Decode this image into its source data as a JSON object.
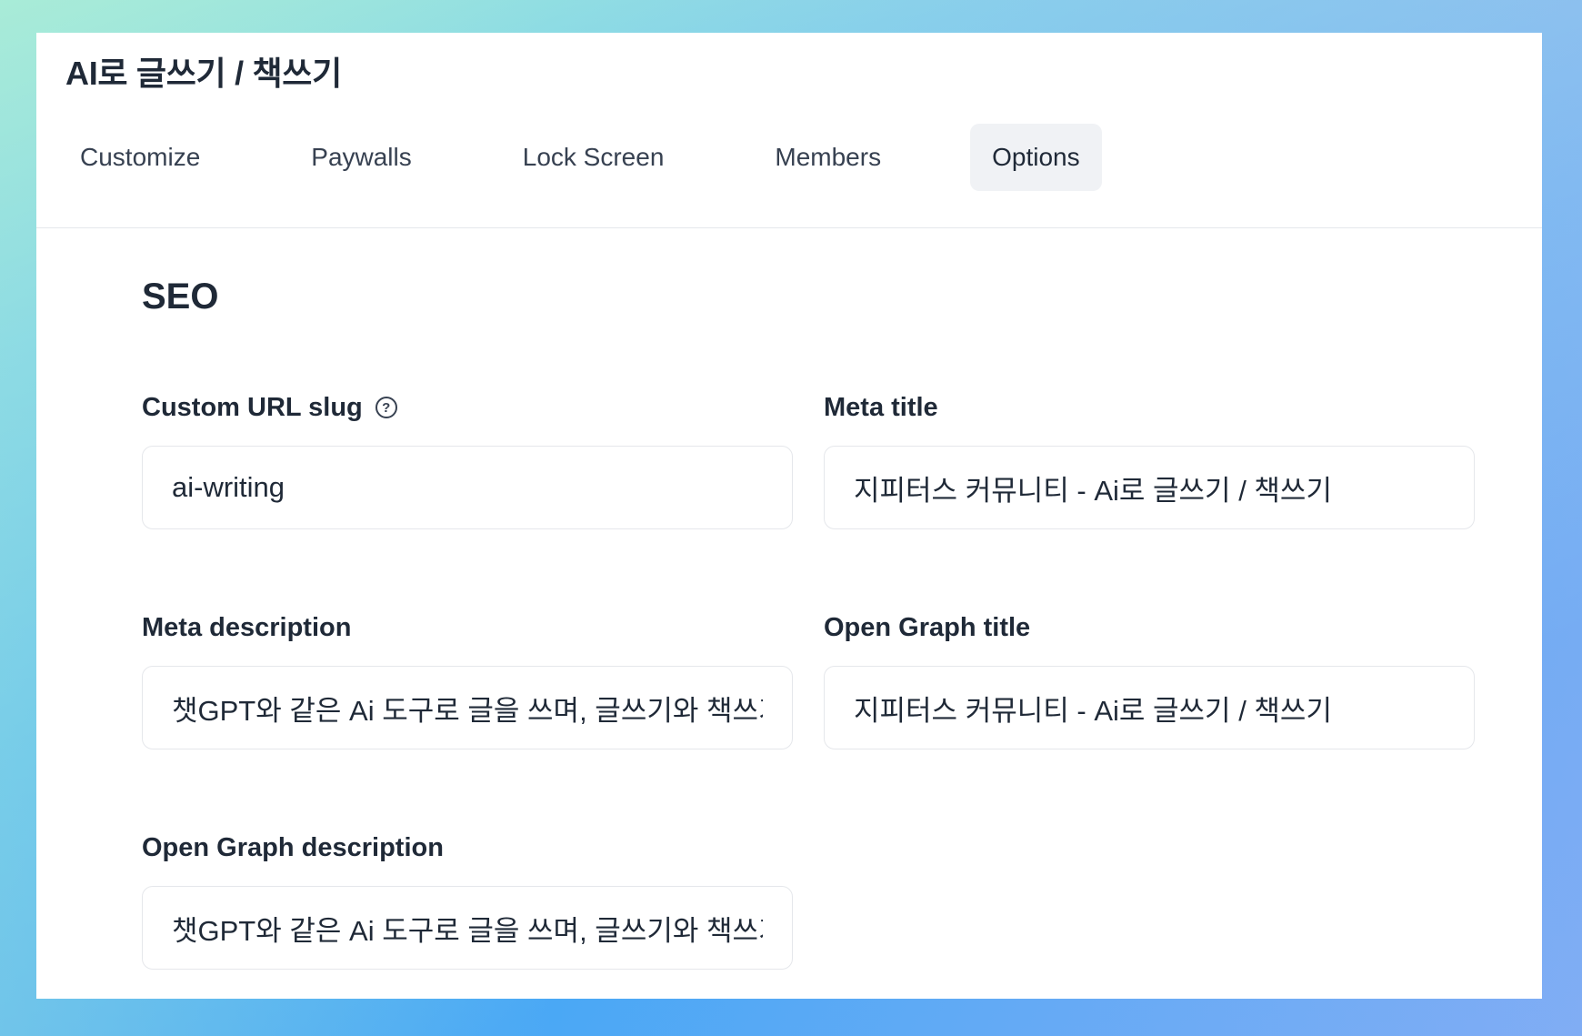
{
  "header": {
    "title": "AI로 글쓰기 / 책쓰기"
  },
  "tabs": [
    {
      "label": "Customize",
      "active": false
    },
    {
      "label": "Paywalls",
      "active": false
    },
    {
      "label": "Lock Screen",
      "active": false
    },
    {
      "label": "Members",
      "active": false
    },
    {
      "label": "Options",
      "active": true
    }
  ],
  "seo": {
    "title": "SEO",
    "custom_url_slug": {
      "label": "Custom URL slug",
      "help_icon": "question-circle-icon",
      "value": "ai-writing"
    },
    "meta_title": {
      "label": "Meta title",
      "value": "지피터스 커뮤니티 - Ai로 글쓰기 / 책쓰기"
    },
    "meta_description": {
      "label": "Meta description",
      "value": "챗GPT와 같은 Ai 도구로 글을 쓰며, 글쓰기와 책쓰기"
    },
    "og_title": {
      "label": "Open Graph title",
      "value": "지피터스 커뮤니티 - Ai로 글쓰기 / 책쓰기"
    },
    "og_description": {
      "label": "Open Graph description",
      "value": "챗GPT와 같은 Ai 도구로 글을 쓰며, 글쓰기와 책쓰기"
    }
  }
}
